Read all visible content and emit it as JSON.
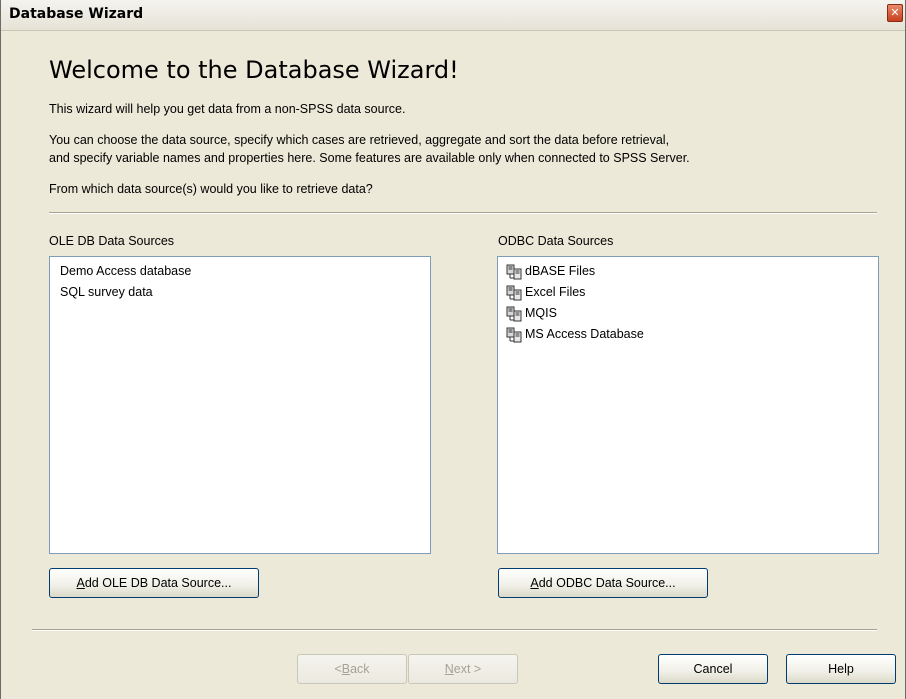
{
  "window": {
    "title": "Database Wizard",
    "close_glyph": "✕"
  },
  "heading": "Welcome to the Database Wizard!",
  "paragraphs": {
    "intro": "This wizard will help you get data from a non-SPSS data source.",
    "desc_line1": "You can choose the data source, specify which cases are retrieved, aggregate and sort the data before retrieval,",
    "desc_line2": "and specify variable names and properties here. Some features are available only when connected to SPSS Server.",
    "question": "From which data source(s) would you like to retrieve data?"
  },
  "ole_db": {
    "label": "OLE DB Data Sources",
    "items": [
      "Demo Access database",
      "SQL survey data"
    ],
    "add_button": {
      "accel": "A",
      "rest": "dd OLE DB Data Source..."
    }
  },
  "odbc": {
    "label": "ODBC Data Sources",
    "items": [
      "dBASE Files",
      "Excel Files",
      "MQIS",
      "MS Access Database"
    ],
    "item_icon": "database-server-icon",
    "add_button": {
      "accel": "A",
      "rest": "dd ODBC Data Source..."
    }
  },
  "footer": {
    "back": {
      "prefix": "< ",
      "accel": "B",
      "rest": "ack",
      "enabled": false
    },
    "next": {
      "accel": "N",
      "rest": "ext >",
      "enabled": false
    },
    "cancel": "Cancel",
    "help": "Help"
  }
}
